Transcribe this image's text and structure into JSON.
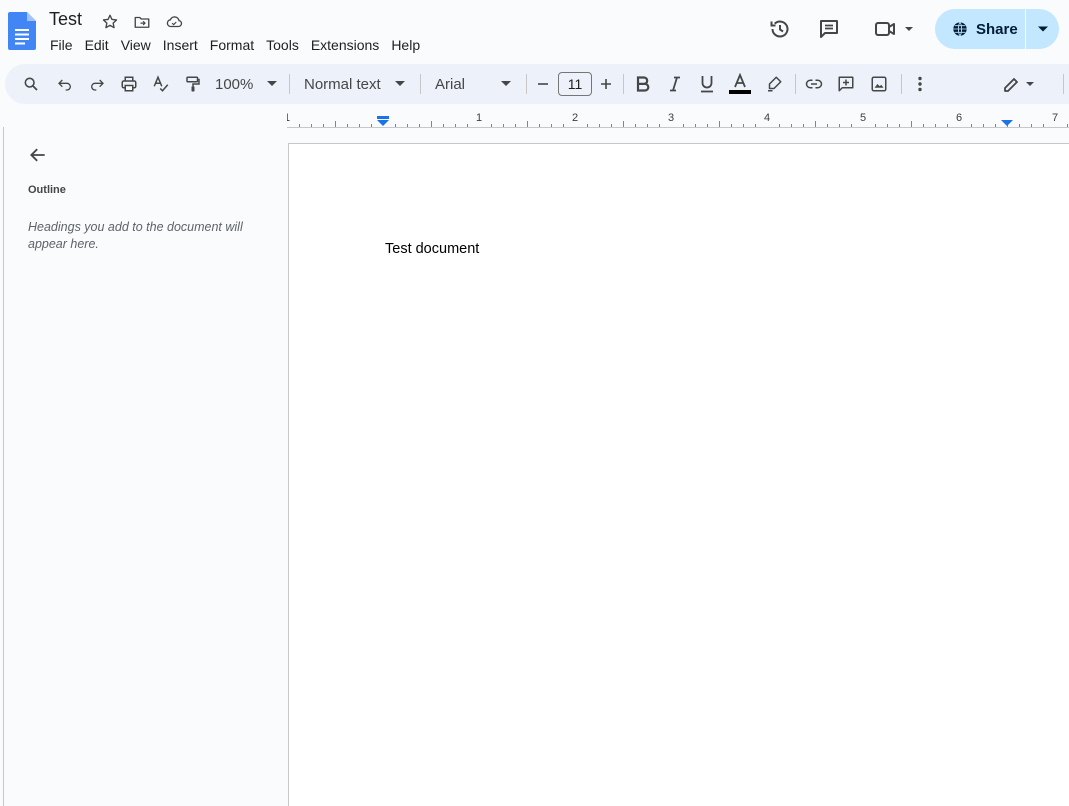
{
  "document": {
    "title": "Test",
    "body_text": "Test document"
  },
  "menubar": {
    "items": [
      "File",
      "Edit",
      "View",
      "Insert",
      "Format",
      "Tools",
      "Extensions",
      "Help"
    ]
  },
  "header": {
    "share_label": "Share"
  },
  "toolbar": {
    "zoom": "100%",
    "style": "Normal text",
    "font": "Arial",
    "font_size": "11"
  },
  "ruler": {
    "numbers": [
      "1",
      "1",
      "2",
      "3",
      "4",
      "5",
      "6",
      "7"
    ]
  },
  "sidebar": {
    "heading": "Outline",
    "hint": "Headings you add to the document will appear here."
  },
  "colors": {
    "accent": "#1a73e8",
    "share_bg": "#c2e7ff",
    "toolbar_bg": "#edf2fa",
    "background": "#f9fbfd"
  }
}
